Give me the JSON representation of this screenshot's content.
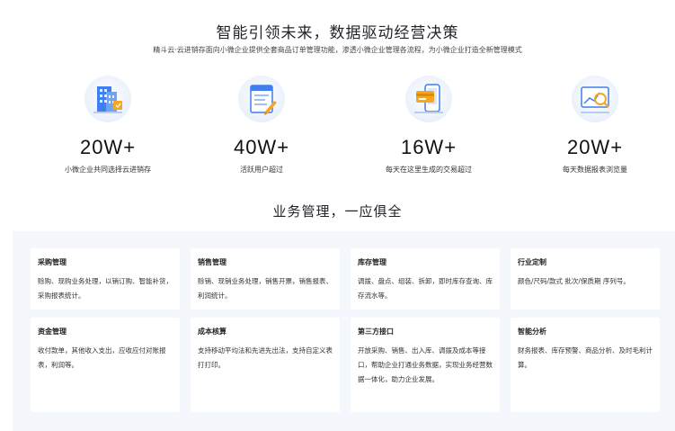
{
  "hero": {
    "title": "智能引领未来，数据驱动经营决策",
    "subtitle": "精斗云·云进销存面向小微企业提供全套商品订单管理功能，渗透小微企业管理各流程，为小微企业打造全新管理模式"
  },
  "stats": [
    {
      "icon": "building-icon",
      "value": "20W+",
      "label": "小微企业共同选择云进销存"
    },
    {
      "icon": "document-edit-icon",
      "value": "40W+",
      "label": "活跃用户超过"
    },
    {
      "icon": "mobile-card-icon",
      "value": "16W+",
      "label": "每天在这里生成的交易超过"
    },
    {
      "icon": "report-chart-icon",
      "value": "20W+",
      "label": "每天数据报表浏览量"
    }
  ],
  "section": {
    "title": "业务管理，一应俱全"
  },
  "cards": [
    {
      "title": "采购管理",
      "desc": "赊购、现购业务处理，以销订购、智能补货，采购报表统计。"
    },
    {
      "title": "销售管理",
      "desc": "赊销、现销业务处理，销售开票，销售报表、利润统计。"
    },
    {
      "title": "库存管理",
      "desc": "调拨、盘点、组装、拆卸，即时库存查询、库存流水等。"
    },
    {
      "title": "行业定制",
      "desc": "颜色/尺码/款式 批次/保质期 序列号。"
    },
    {
      "title": "资金管理",
      "desc": "收付款单，其他收入支出，应收应付对账报表，利润等。"
    },
    {
      "title": "成本核算",
      "desc": "支持移动平均法和先进先出法，支持自定义表打打印。"
    },
    {
      "title": "第三方接口",
      "desc": "开放采购、销售、出入库、调拨及成本等接口，帮助企业打通业务数据，实现业务经营数据一体化，助力企业发展。"
    },
    {
      "title": "智能分析",
      "desc": "财务报表、库存预警、商品分析、及时毛利计算。"
    }
  ],
  "colors": {
    "accent": "#3a78f2",
    "panel": "#f4f7fb",
    "orange": "#f5a623"
  }
}
